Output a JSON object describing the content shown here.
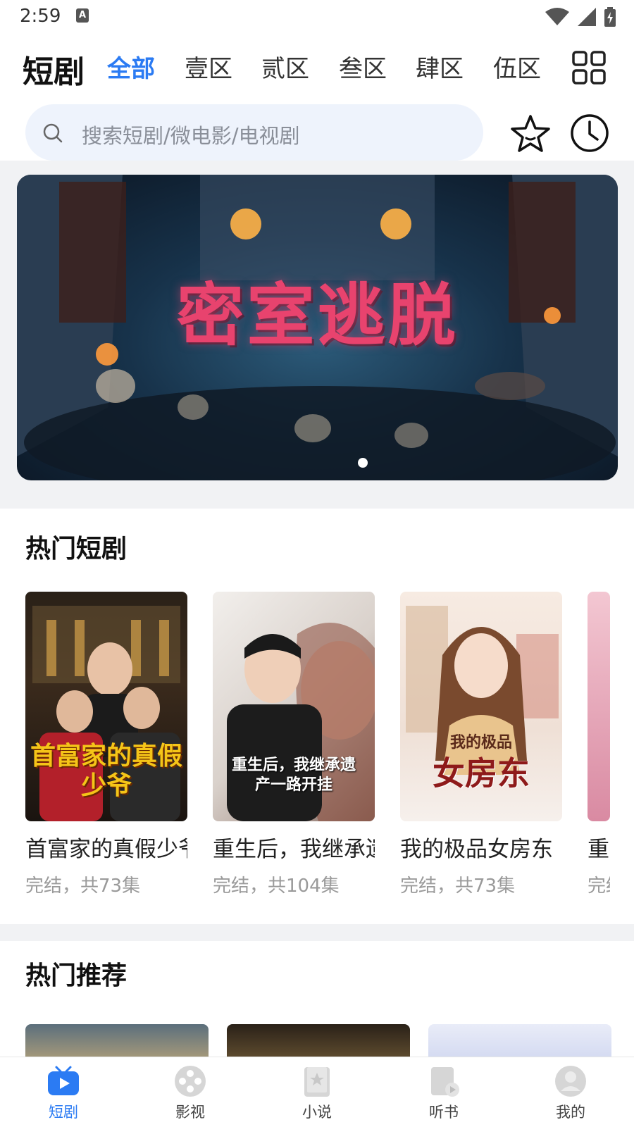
{
  "status_bar": {
    "time": "2:59",
    "notification_icon": "A"
  },
  "header": {
    "brand": "短剧",
    "tabs": [
      {
        "label": "全部",
        "active": true
      },
      {
        "label": "壹区",
        "active": false
      },
      {
        "label": "贰区",
        "active": false
      },
      {
        "label": "叁区",
        "active": false
      },
      {
        "label": "肆区",
        "active": false
      },
      {
        "label": "伍区",
        "active": false
      }
    ],
    "grid_icon": "grid-icon"
  },
  "search": {
    "placeholder": "搜索短剧/微电影/电视剧",
    "star_icon": "star-icon",
    "history_icon": "clock-icon"
  },
  "banner": {
    "title": "密室逃脱",
    "page_count": 1,
    "active_index": 0
  },
  "hot_dramas": {
    "title": "热门短剧",
    "items": [
      {
        "title": "首富家的真假少爷",
        "subtitle": "完结，共73集",
        "poster_text": "首富家的真假少爷"
      },
      {
        "title": "重生后，我继承遗产一路开挂",
        "subtitle": "完结，共104集",
        "poster_text": "重生后，我继承遗产一路开挂"
      },
      {
        "title": "我的极品女房东",
        "subtitle": "完结，共73集",
        "poster_text": "女房东",
        "poster_kicker": "我的极品"
      },
      {
        "title": "重",
        "subtitle": "完结"
      }
    ]
  },
  "recommended": {
    "title": "热门推荐"
  },
  "bottom_nav": [
    {
      "label": "短剧",
      "icon": "play-tv-icon",
      "active": true
    },
    {
      "label": "影视",
      "icon": "film-reel-icon",
      "active": false
    },
    {
      "label": "小说",
      "icon": "book-icon",
      "active": false
    },
    {
      "label": "听书",
      "icon": "audiobook-icon",
      "active": false
    },
    {
      "label": "我的",
      "icon": "user-icon",
      "active": false
    }
  ],
  "colors": {
    "accent": "#2b7bf3",
    "search_bg": "#eef3fc",
    "separator": "#f1f2f4",
    "banner_title": "#e8436e"
  }
}
